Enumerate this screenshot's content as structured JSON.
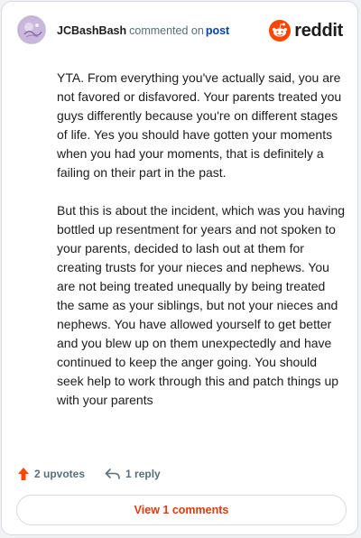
{
  "comment": {
    "username": "JCBashBash",
    "action_text": "commented on",
    "post_link": "post",
    "paragraphs": [
      "YTA. From everything you've actually said, you are not favored or disfavored. Your parents treated you guys differently because you're on different stages of life. Yes you should have gotten your moments when you had your moments, that is definitely a failing on their part in the past.",
      "But this is about the incident, which was you having bottled up resentment for years and not spoken to your parents, decided to lash out at them for creating trusts for your nieces and nephews. You are not being treated unequally by being treated the same as your siblings, but not your nieces and nephews. You have allowed yourself to get better and you blew up on them unexpectedly and have continued to keep the anger going. You should seek help to work through this and patch things up with your parents"
    ]
  },
  "brand": {
    "name": "reddit",
    "icon": "reddit-logo-icon",
    "color": "#ff4500"
  },
  "footer": {
    "upvotes": "2 upvotes",
    "upvote_icon": "upvote-arrow-icon",
    "replies": "1 reply",
    "reply_icon": "reply-arrow-icon",
    "upvote_color": "#ff4500"
  },
  "view_button": {
    "label": "View 1 comments",
    "color": "#e03a0b"
  }
}
